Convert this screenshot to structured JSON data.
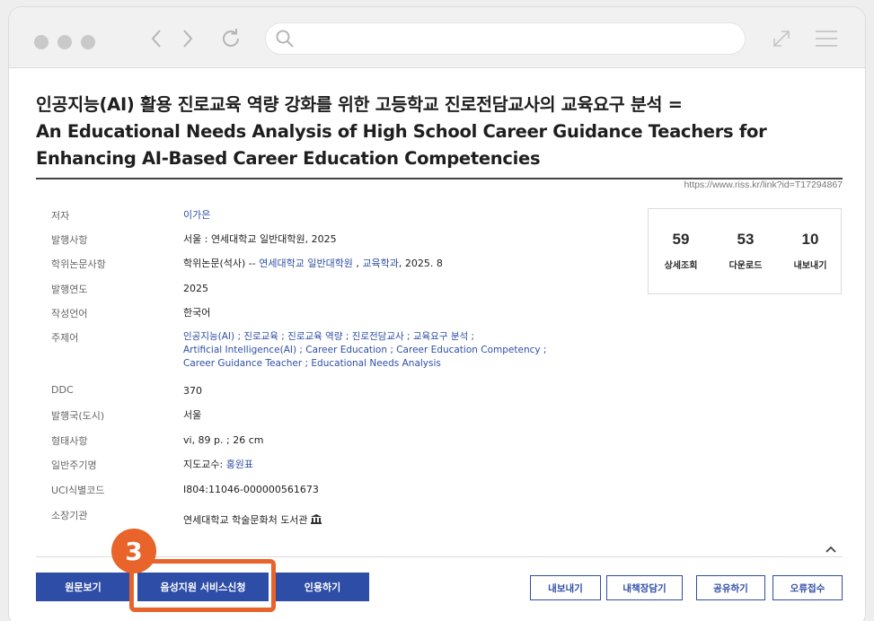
{
  "browser": {
    "traffic_lights": [
      "close",
      "minimize",
      "maximize"
    ],
    "nav_icons": [
      "chevron-left-icon",
      "chevron-right-icon",
      "reload-icon"
    ],
    "search_icon": "search-icon",
    "right_icons": [
      "expand-icon",
      "menu-icon"
    ]
  },
  "record": {
    "title_lines": [
      "인공지능(AI) 활용 진로교육 역량 강화를 위한 고등학교 진로전담교사의 교육요구 분석 =",
      "An Educational Needs Analysis of High School Career Guidance Teachers for",
      "Enhancing AI-Based Career Education Competencies"
    ],
    "permalink": "https://www.riss.kr/link?id=T17294867",
    "fields": {
      "author": {
        "label": "저자",
        "value": "이가은"
      },
      "publication": {
        "label": "발행사항",
        "value": "서울 : 연세대학교 일반대학원, 2025"
      },
      "degree": {
        "label": "학위논문사항",
        "value_prefix": "학위논문(석사) -- ",
        "university": "연세대학교 일반대학원",
        "sep": " , ",
        "dept": "교육학과",
        "year": ", 2025. 8"
      },
      "year": {
        "label": "발행연도",
        "value": "2025"
      },
      "language": {
        "label": "작성언어",
        "value": "한국어"
      },
      "subjects": {
        "label": "주제어",
        "lines": [
          "인공지능(AI) ; 진로교육 ; 진로교육 역량 ; 진로전담교사 ; 교육요구 분석 ;",
          "Artificial Intelligence(AI) ; Career Education ; Career Education Competency ;",
          "Career Guidance Teacher ; Educational Needs Analysis"
        ]
      },
      "ddc": {
        "label": "DDC",
        "value": "370"
      },
      "country": {
        "label": "발행국(도시)",
        "value": "서울"
      },
      "format": {
        "label": "형태사항",
        "value": "vi, 89 p. ; 26 cm"
      },
      "note": {
        "label": "일반주기명",
        "prefix": "지도교수: ",
        "advisor": "홍원표"
      },
      "uci": {
        "label": "UCI식별코드",
        "value": "I804:11046-000000561673"
      },
      "holding": {
        "label": "소장기관",
        "value": "연세대학교 학술문화처 도서관",
        "icon": "library-icon"
      }
    }
  },
  "stats": [
    {
      "num": "59",
      "label": "상세조회"
    },
    {
      "num": "53",
      "label": "다운로드"
    },
    {
      "num": "10",
      "label": "내보내기"
    }
  ],
  "actions": {
    "original": "원문보기",
    "voice": "음성지원 서비스신청",
    "cite": "인용하기",
    "export": "내보내기",
    "bookshelf": "내책장담기",
    "share": "공유하기",
    "report": "오류접수"
  },
  "annotation": {
    "step": "3",
    "color": "#e8642a"
  },
  "colors": {
    "accent": "#2e4da7",
    "link": "#2f4fa8",
    "highlight": "#e8642a"
  }
}
